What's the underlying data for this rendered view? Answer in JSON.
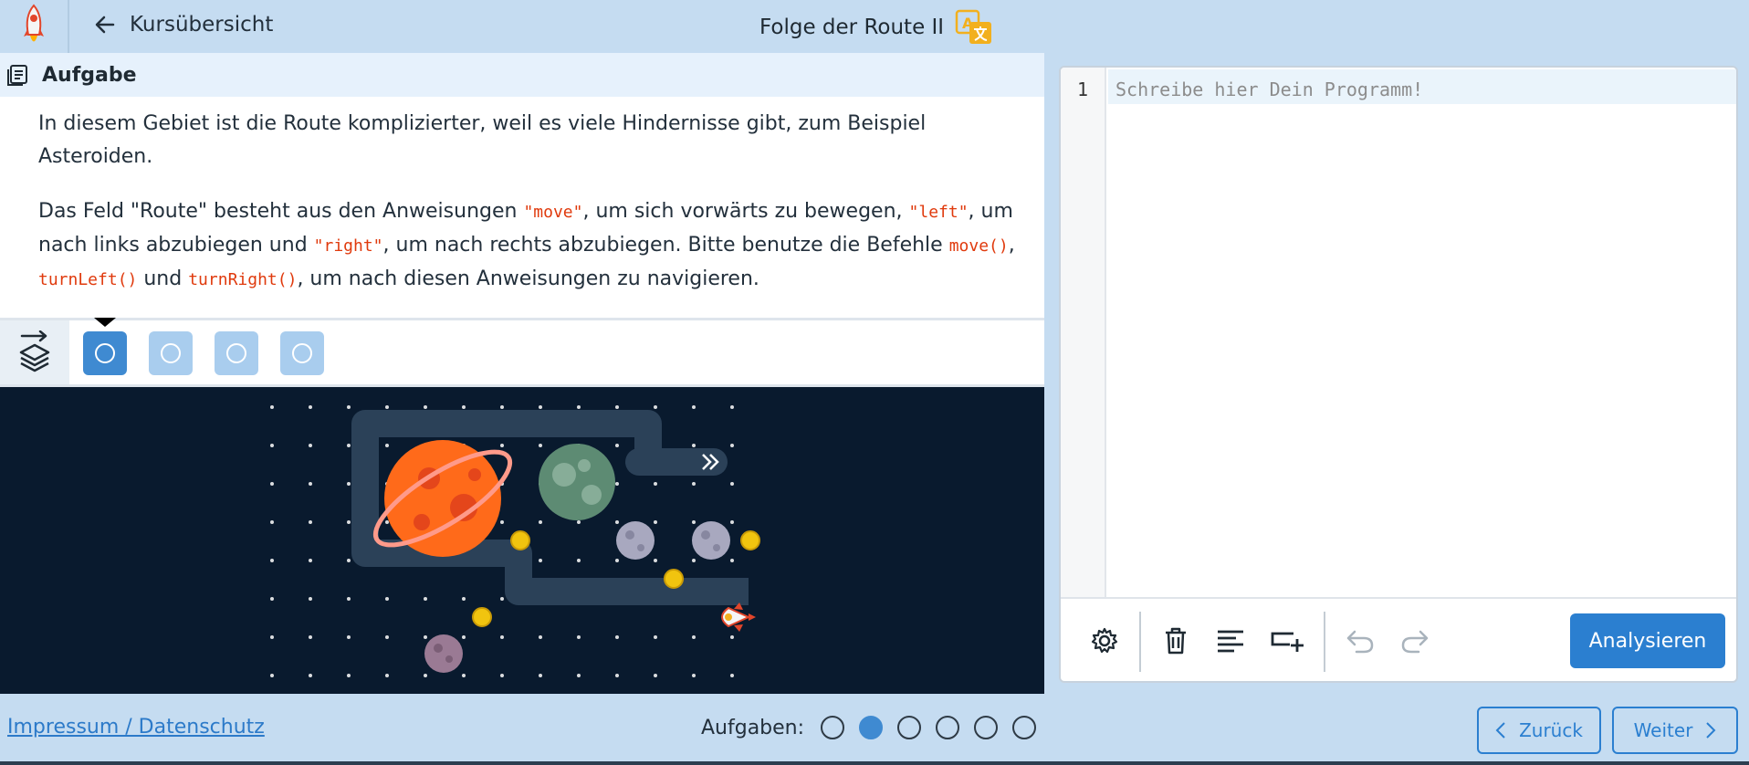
{
  "header": {
    "back_label": "Kursübersicht",
    "title": "Folge der Route II"
  },
  "task": {
    "heading": "Aufgabe",
    "paragraph1": "In diesem Gebiet ist die Route komplizierter, weil es viele Hindernisse gibt, zum Beispiel Asteroiden.",
    "p2_text1": "Das Feld \"Route\" besteht aus den Anweisungen ",
    "p2_code1": "\"move\"",
    "p2_text2": ", um sich vorwärts zu bewegen, ",
    "p2_code2": "\"left\"",
    "p2_text3": ", um nach links abzubiegen und ",
    "p2_code3": "\"right\"",
    "p2_text4": ", um nach rechts abzubiegen. Bitte benutze die Befehle ",
    "p2_code4": "move()",
    "p2_text5": ", ",
    "p2_code5": "turnLeft()",
    "p2_text6": " und ",
    "p2_code6": "turnRight()",
    "p2_text7": ", um nach diesen Anweisungen zu navigieren."
  },
  "levels": {
    "count": 4,
    "active_index": 0
  },
  "editor": {
    "line_number": "1",
    "placeholder": "Schreibe hier Dein Programm!",
    "analyse_label": "Analysieren"
  },
  "footer": {
    "imprint_label": "Impressum / Datenschutz",
    "tasks_label": "Aufgaben:",
    "task_count": 6,
    "current_task": 2,
    "back_label": "Zurück",
    "next_label": "Weiter"
  },
  "icons": {
    "logo": "rocket-logo-icon",
    "back": "arrow-left-icon",
    "translate": "translate-icon",
    "task": "document-list-icon",
    "layers": "layers-icon",
    "settings": "gear-icon",
    "delete": "trash-icon",
    "format": "align-left-icon",
    "insert": "insert-row-icon",
    "undo": "undo-icon",
    "redo": "redo-icon"
  },
  "colors": {
    "accent": "#2b7fd0",
    "header_bg": "#c5dcf1",
    "code_red": "#e03a0d",
    "scene_bg": "#091a2e"
  }
}
